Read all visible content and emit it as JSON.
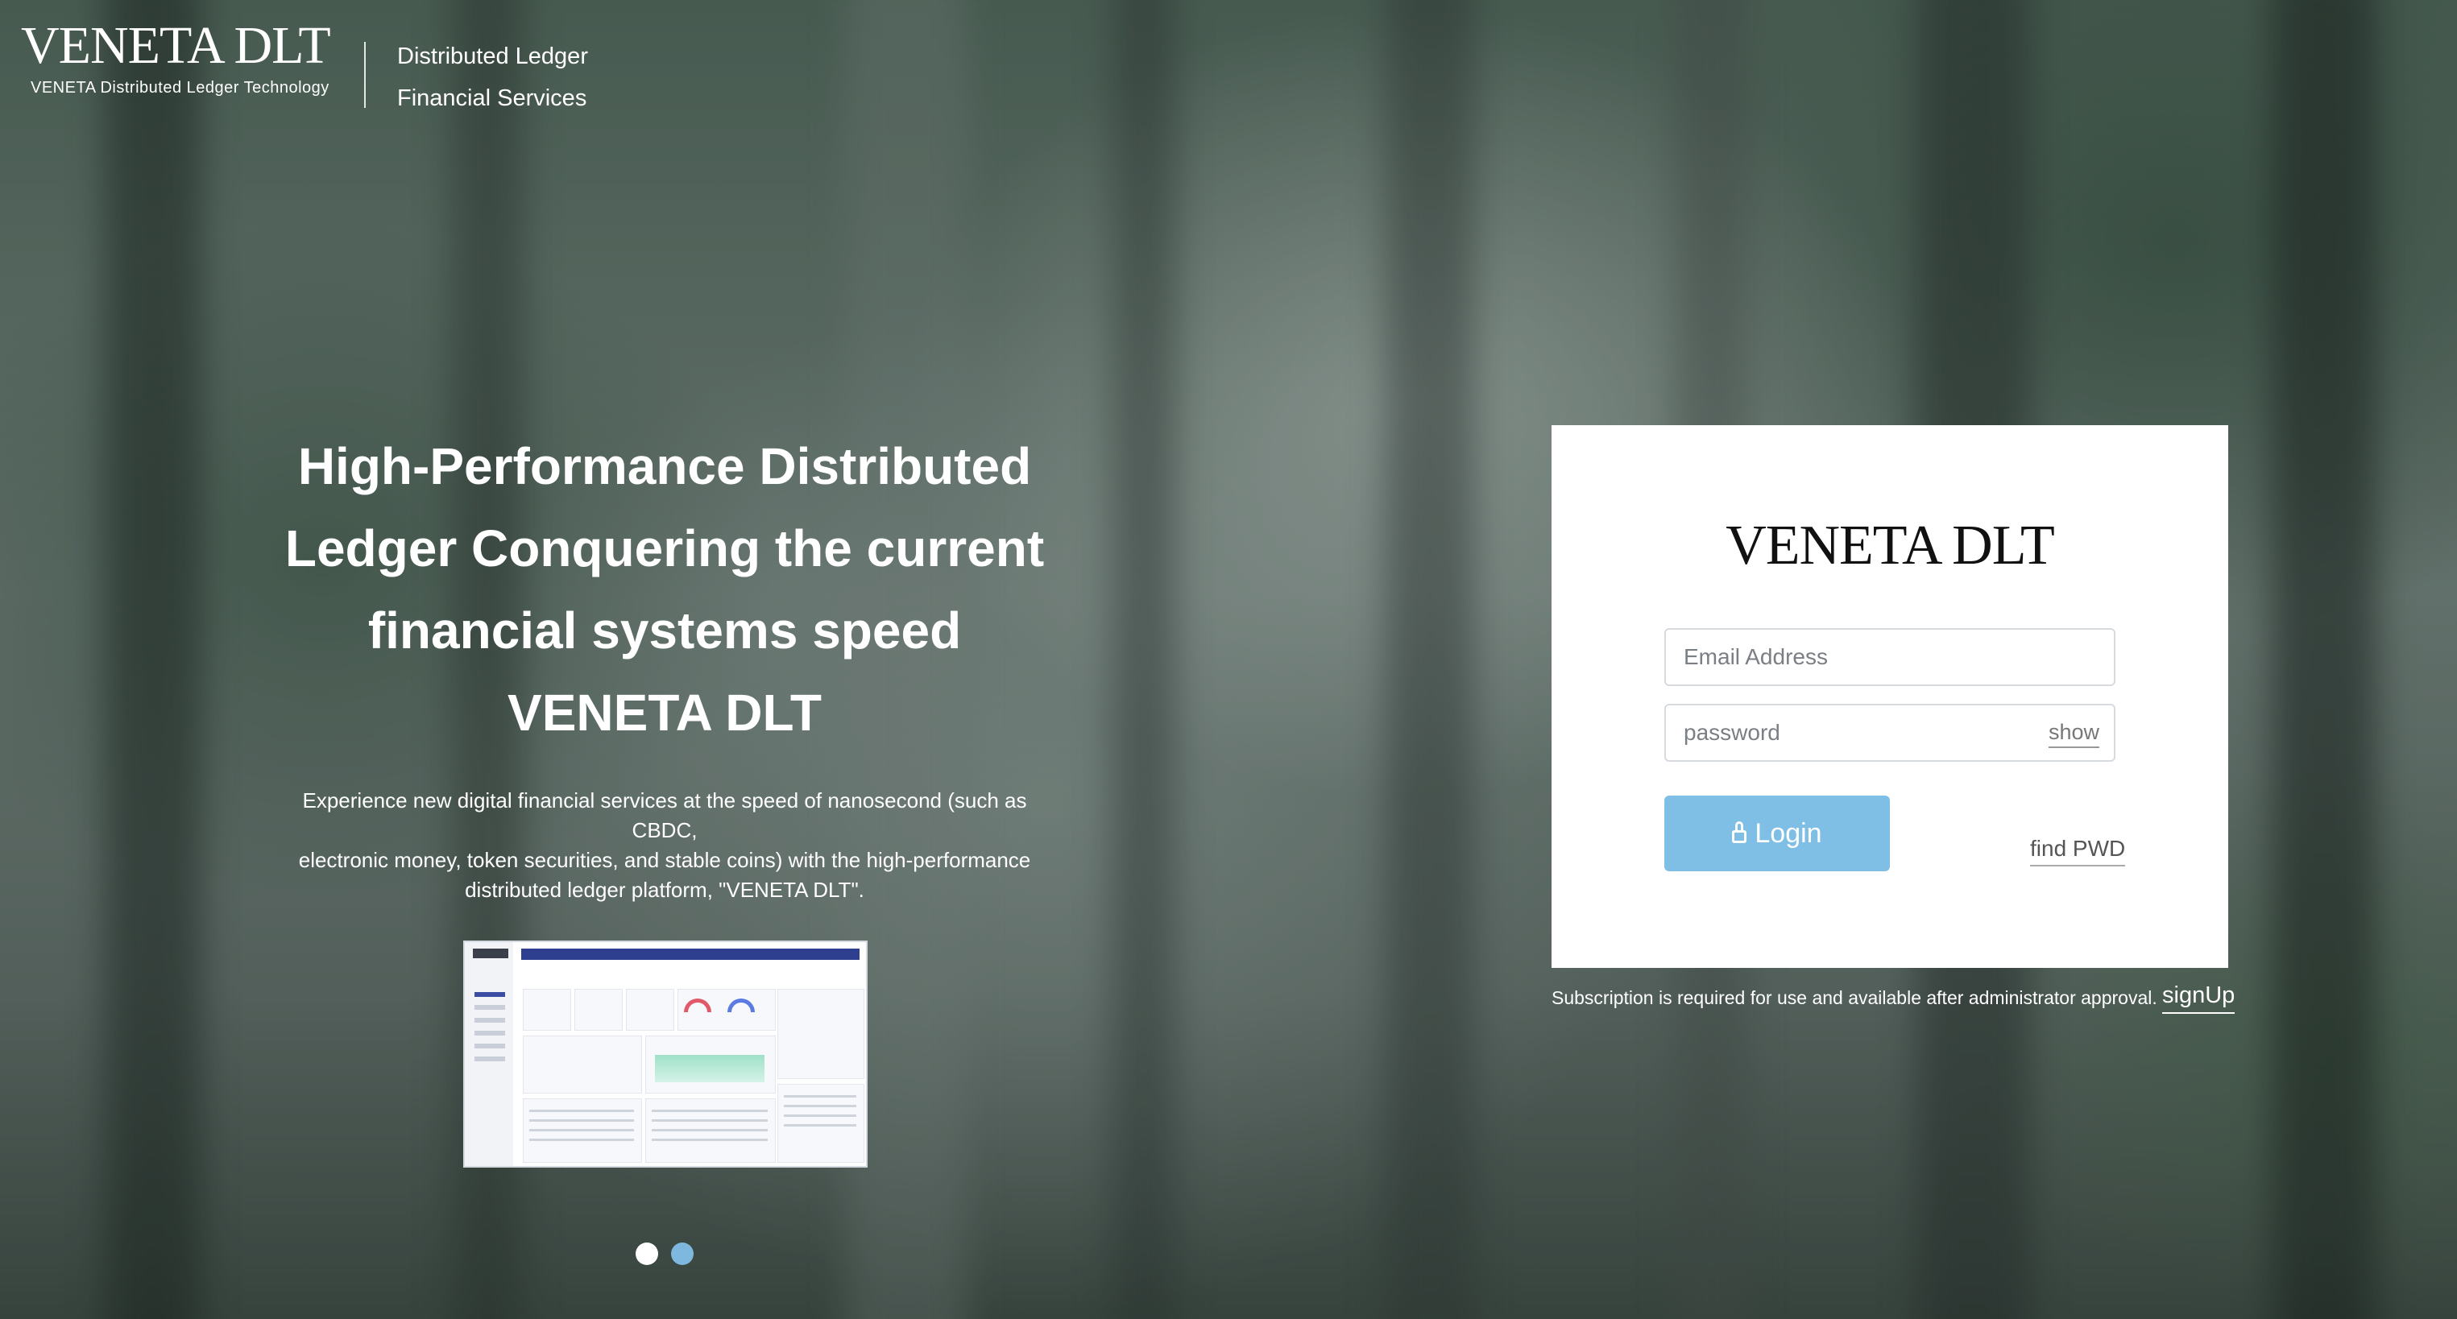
{
  "header": {
    "brand_name": "VENETA DLT",
    "brand_sub": "VENETA Distributed Ledger Technology",
    "tagline_line1": "Distributed Ledger",
    "tagline_line2": "Financial Services"
  },
  "hero": {
    "title_lines": [
      "High-Performance Distributed",
      "Ledger Conquering the current",
      "financial systems speed",
      "VENETA DLT"
    ],
    "desc_lines": [
      "Experience new digital financial services at the speed of nanosecond (such as CBDC,",
      "electronic money, token securities, and stable coins) with the high-performance",
      "distributed ledger platform,  \"VENETA DLT\"."
    ]
  },
  "carousel": {
    "slide_count": 2,
    "active_index": 0
  },
  "login": {
    "logo_text": "VENETA DLT",
    "email_placeholder": "Email Address",
    "password_placeholder": "password",
    "show_label": "show",
    "login_label": "Login",
    "find_pwd_label": "find PWD"
  },
  "footer": {
    "subscription_note": "Subscription is required for use and available after administrator approval.",
    "signup_label": "signUp"
  },
  "colors": {
    "login_button": "#7fbfe5",
    "dot_active": "#ffffff",
    "dot_inactive": "#7fb8df"
  }
}
